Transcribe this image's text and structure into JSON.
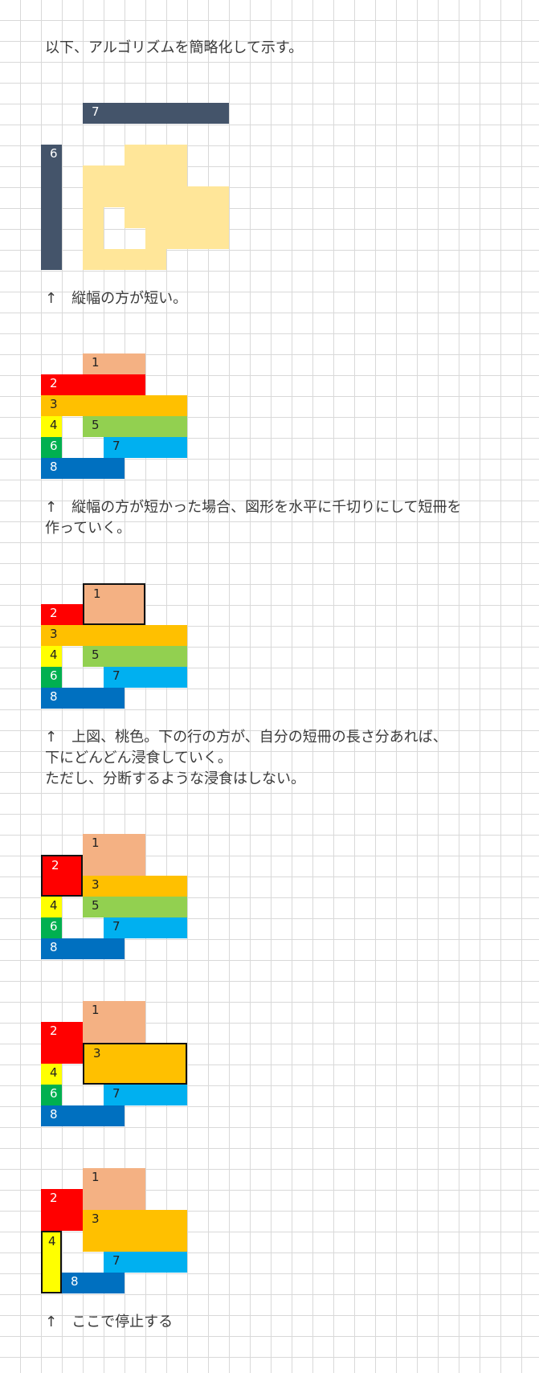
{
  "texts": {
    "intro": "以下、アルゴリズムを簡略化して示す。",
    "caption1": "↑　縦幅の方が短い。",
    "caption2_line1": "↑　縦幅の方が短かった場合、図形を水平に千切りにして短冊を",
    "caption2_line2": "作っていく。",
    "caption3_line1": "↑　上図、桃色。下の行の方が、自分の短冊の長さ分あれば、",
    "caption3_line2": "下にどんどん浸食していく。",
    "caption3_line3": "ただし、分断するような浸食はしない。",
    "caption_final": "↑　ここで停止する"
  },
  "labels": {
    "n1": "1",
    "n2": "2",
    "n3": "3",
    "n4": "4",
    "n5": "5",
    "n6": "6",
    "n7": "7",
    "n8": "8"
  },
  "colors": {
    "slate": "#44546a",
    "light_yellow": "#ffe699",
    "peach": "#f4b183",
    "red": "#ff0000",
    "orange": "#ffc000",
    "yellow": "#ffff00",
    "light_green": "#92d050",
    "green": "#00b050",
    "sky_blue": "#00b0f0",
    "blue": "#0070c0"
  }
}
